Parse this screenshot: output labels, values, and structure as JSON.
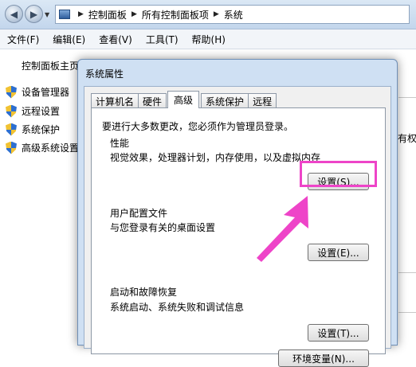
{
  "explorer": {
    "breadcrumb": [
      "控制面板",
      "所有控制面板项",
      "系统"
    ],
    "menu": [
      "文件(F)",
      "编辑(E)",
      "查看(V)",
      "工具(T)",
      "帮助(H)"
    ],
    "sidebar": {
      "home_link": "控制面板主页",
      "tasks": [
        "设备管理器",
        "远程设置",
        "系统保护",
        "高级系统设置"
      ]
    },
    "right_peek_text": "有权"
  },
  "dialog": {
    "title": "系统属性",
    "tabs": [
      "计算机名",
      "硬件",
      "高级",
      "系统保护",
      "远程"
    ],
    "active_tab": "高级",
    "admin_note": "要进行大多数更改，您必须作为管理员登录。",
    "performance": {
      "title": "性能",
      "desc": "视觉效果，处理器计划，内存使用，以及虚拟内存",
      "button": "设置(S)..."
    },
    "user_profiles": {
      "title": "用户配置文件",
      "desc": "与您登录有关的桌面设置",
      "button": "设置(E)..."
    },
    "startup_recovery": {
      "title": "启动和故障恢复",
      "desc": "系统启动、系统失败和调试信息",
      "button": "设置(T)..."
    },
    "env_button": "环境变量(N)..."
  },
  "annotation": {
    "color": "#ee44c8"
  }
}
